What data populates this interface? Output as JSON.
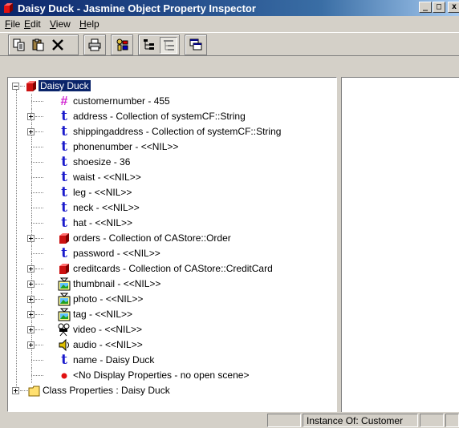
{
  "window": {
    "title": "Daisy Duck - Jasmine Object Property Inspector",
    "controls": {
      "minimize": "_",
      "maximize": "□",
      "close": "x"
    }
  },
  "menu": [
    {
      "label": "File",
      "hotkey": "F",
      "rest": "ile"
    },
    {
      "label": "Edit",
      "hotkey": "E",
      "rest": "dit"
    },
    {
      "label": "View",
      "hotkey": "V",
      "rest": "iew"
    },
    {
      "label": "Help",
      "hotkey": "H",
      "rest": "elp"
    }
  ],
  "toolbar": {
    "icons": [
      "copy-icon",
      "paste-icon",
      "delete-icon",
      "print-icon",
      "properties-icon",
      "tree-view-icon",
      "list-view-icon",
      "window-icon"
    ]
  },
  "tree": {
    "root": {
      "label": "Daisy Duck",
      "icon": "red-cube-icon"
    },
    "items": [
      {
        "label": "customernumber - 455",
        "icon": "hash",
        "expandable": false
      },
      {
        "label": "address - Collection of systemCF::String",
        "icon": "t",
        "expandable": true
      },
      {
        "label": "shippingaddress - Collection of systemCF::String",
        "icon": "t",
        "expandable": true
      },
      {
        "label": "phonenumber - <<NIL>>",
        "icon": "t",
        "expandable": false
      },
      {
        "label": "shoesize - 36",
        "icon": "t",
        "expandable": false
      },
      {
        "label": "waist - <<NIL>>",
        "icon": "t",
        "expandable": false
      },
      {
        "label": "leg - <<NIL>>",
        "icon": "t",
        "expandable": false
      },
      {
        "label": "neck - <<NIL>>",
        "icon": "t",
        "expandable": false
      },
      {
        "label": "hat - <<NIL>>",
        "icon": "t",
        "expandable": false
      },
      {
        "label": "orders - Collection of CAStore::Order",
        "icon": "cube",
        "expandable": true
      },
      {
        "label": "password - <<NIL>>",
        "icon": "t",
        "expandable": false
      },
      {
        "label": "creditcards - Collection of CAStore::CreditCard",
        "icon": "cube",
        "expandable": true
      },
      {
        "label": "thumbnail - <<NIL>>",
        "icon": "image",
        "expandable": true
      },
      {
        "label": "photo - <<NIL>>",
        "icon": "image",
        "expandable": true
      },
      {
        "label": "tag - <<NIL>>",
        "icon": "image",
        "expandable": true
      },
      {
        "label": "video - <<NIL>>",
        "icon": "video",
        "expandable": true
      },
      {
        "label": "audio - <<NIL>>",
        "icon": "audio",
        "expandable": true
      },
      {
        "label": "name - Daisy Duck",
        "icon": "t",
        "expandable": false
      },
      {
        "label": "<No Display Properties - no open scene>",
        "icon": "red-dot",
        "expandable": false
      }
    ],
    "class_node": {
      "label": "Class Properties : Daisy Duck",
      "icon": "folder-icon"
    }
  },
  "status": {
    "cells": [
      "",
      "Instance Of: Customer",
      "",
      ""
    ]
  },
  "colors": {
    "title_start": "#0a246a",
    "title_end": "#a6caf0",
    "selection": "#0a246a",
    "type_icon": "#1a1acc",
    "hash_icon": "#d020d0",
    "cube": "#cc1111"
  }
}
